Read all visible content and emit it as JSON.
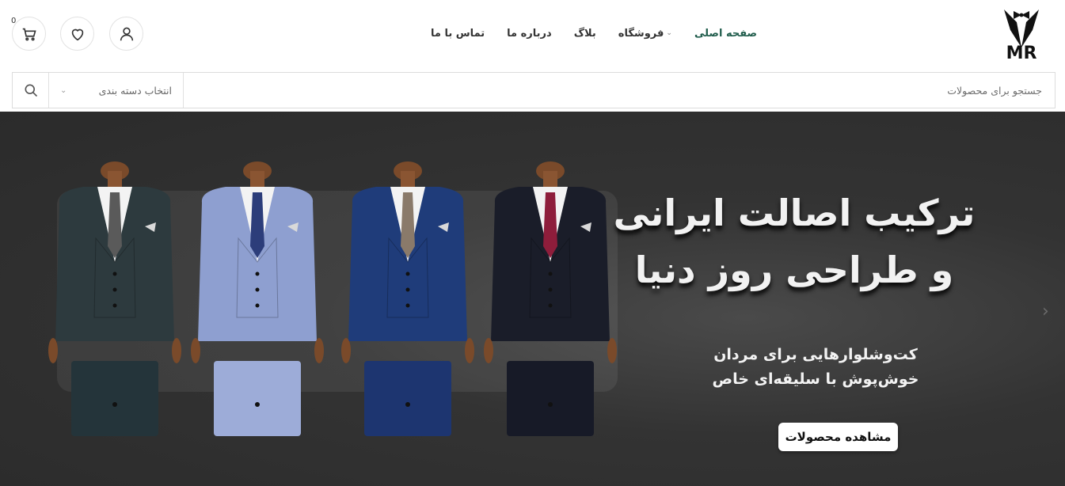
{
  "header": {
    "logo_text": "MR",
    "nav": [
      {
        "label": "صفحه اصلی",
        "active": true,
        "has_dropdown": false
      },
      {
        "label": "فروشگاه",
        "active": false,
        "has_dropdown": true
      },
      {
        "label": "بلاگ",
        "active": false,
        "has_dropdown": false
      },
      {
        "label": "درباره ما",
        "active": false,
        "has_dropdown": false
      },
      {
        "label": "تماس با ما",
        "active": false,
        "has_dropdown": false
      }
    ],
    "icons": {
      "account": "user-icon",
      "wishlist": "heart-icon",
      "cart": "cart-icon"
    },
    "cart_count": "0"
  },
  "search": {
    "placeholder": "جستجو برای محصولات",
    "category_label": "انتخاب دسته بندی",
    "button_icon": "search-icon"
  },
  "hero": {
    "title_line1": "ترکیب اصالت ایرانی",
    "title_line2": "و طراحی روز دنیا",
    "subtitle_line1": "کت‌وشلوارهایی برای مردان",
    "subtitle_line2": "خوش‌پوش با سلیقه‌ای خاص",
    "cta_label": "مشاهده محصولات",
    "suits": [
      {
        "jacket": "#2d3a3e",
        "tie": "#5a5a5a",
        "trousers": "#24343a"
      },
      {
        "jacket": "#8e9fd0",
        "tie": "#2c3d7a",
        "trousers": "#9dacd8"
      },
      {
        "jacket": "#1f3c7a",
        "tie": "#8a7a6a",
        "trousers": "#1d3570"
      },
      {
        "jacket": "#1a1d29",
        "tie": "#8e1d3b",
        "trousers": "#171a27"
      }
    ]
  },
  "colors": {
    "accent": "#1f5c4b",
    "hero_bg": "#2f2f2f"
  }
}
